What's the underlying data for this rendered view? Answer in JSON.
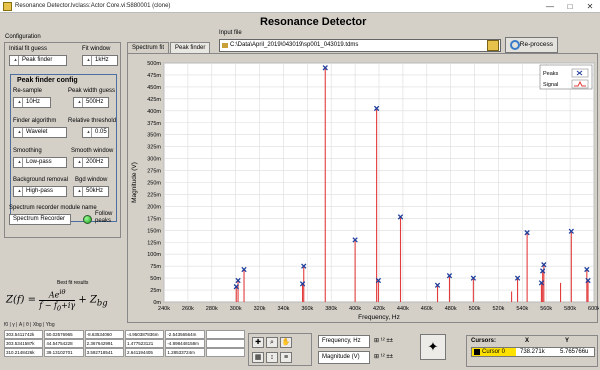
{
  "window": {
    "title": "Resonance Detector.lvclass:Actor Core.vi:5880001 (clone)",
    "controls": [
      "—",
      "□",
      "✕"
    ]
  },
  "app_title": "Resonance Detector",
  "configuration": {
    "label": "Configuration",
    "initial_fit_guess": {
      "label": "Initial fit guess",
      "value": "Peak finder"
    },
    "fit_window": {
      "label": "Fit window",
      "value": "1kHz"
    },
    "peak_finder": {
      "title": "Peak finder config",
      "resample": {
        "label": "Re-sample",
        "value": "10Hz"
      },
      "peak_width_guess": {
        "label": "Peak width guess",
        "value": "500Hz"
      },
      "finder_algorithm": {
        "label": "Finder algorithm",
        "value": "Wavelet"
      },
      "relative_threshold": {
        "label": "Relative threshold",
        "value": "0.05"
      },
      "smoothing": {
        "label": "Smoothing",
        "value": "Low-pass"
      },
      "smooth_window": {
        "label": "Smooth window",
        "value": "200Hz"
      },
      "background_removal": {
        "label": "Background removal",
        "value": "High-pass"
      },
      "bgd_window": {
        "label": "Bgd window",
        "value": "50kHz"
      }
    },
    "recorder": {
      "label": "Spectrum recorder module name",
      "value": "Spectrum Recorder",
      "follow_label": "Follow peaks"
    }
  },
  "tabs": [
    {
      "label": "Spectrum fit",
      "active": false
    },
    {
      "label": "Peak finder",
      "active": true
    }
  ],
  "input_file": {
    "label": "Input file",
    "path": "C:\\Data\\April_2019\\043019\\sp001_043019.tdms"
  },
  "reprocess_label": "Re-process",
  "legend": [
    {
      "name": "Peaks",
      "color": "#1f3e9c"
    },
    {
      "name": "Signal",
      "color": "#e23c3c"
    }
  ],
  "chart_data": {
    "type": "line",
    "xlabel": "Frequency, Hz",
    "ylabel": "Magnitude (V)",
    "xlim": [
      240000,
      600000
    ],
    "ylim": [
      0,
      500
    ],
    "x_ticks": [
      "240k",
      "260k",
      "280k",
      "300k",
      "320k",
      "340k",
      "360k",
      "380k",
      "400k",
      "420k",
      "440k",
      "460k",
      "480k",
      "500k",
      "520k",
      "540k",
      "560k",
      "580k",
      "600k"
    ],
    "y_ticks": [
      "0m",
      "25m",
      "50m",
      "75m",
      "100m",
      "125m",
      "150m",
      "175m",
      "200m",
      "225m",
      "250m",
      "275m",
      "300m",
      "325m",
      "350m",
      "375m",
      "400m",
      "425m",
      "450m",
      "475m",
      "500m"
    ],
    "grid": true,
    "legend_position": "top-right",
    "signal_peaks": [
      {
        "x": 300500,
        "y": 32
      },
      {
        "x": 302000,
        "y": 45
      },
      {
        "x": 307000,
        "y": 68
      },
      {
        "x": 356000,
        "y": 38
      },
      {
        "x": 357000,
        "y": 75
      },
      {
        "x": 375000,
        "y": 490
      },
      {
        "x": 400000,
        "y": 130
      },
      {
        "x": 418000,
        "y": 405
      },
      {
        "x": 419500,
        "y": 45
      },
      {
        "x": 438000,
        "y": 178
      },
      {
        "x": 469000,
        "y": 35
      },
      {
        "x": 479000,
        "y": 55
      },
      {
        "x": 499000,
        "y": 50
      },
      {
        "x": 531000,
        "y": 22
      },
      {
        "x": 536000,
        "y": 50
      },
      {
        "x": 544000,
        "y": 145
      },
      {
        "x": 556000,
        "y": 40
      },
      {
        "x": 557000,
        "y": 65
      },
      {
        "x": 558000,
        "y": 78
      },
      {
        "x": 572000,
        "y": 40
      },
      {
        "x": 581000,
        "y": 148
      },
      {
        "x": 594000,
        "y": 68
      },
      {
        "x": 595000,
        "y": 45
      }
    ],
    "detected_peaks": [
      {
        "x": 300500,
        "y": 32
      },
      {
        "x": 302000,
        "y": 45
      },
      {
        "x": 307000,
        "y": 68
      },
      {
        "x": 356000,
        "y": 38
      },
      {
        "x": 357000,
        "y": 75
      },
      {
        "x": 375000,
        "y": 490
      },
      {
        "x": 400000,
        "y": 130
      },
      {
        "x": 418000,
        "y": 405
      },
      {
        "x": 419500,
        "y": 45
      },
      {
        "x": 438000,
        "y": 178
      },
      {
        "x": 469000,
        "y": 35
      },
      {
        "x": 479000,
        "y": 55
      },
      {
        "x": 499000,
        "y": 50
      },
      {
        "x": 536000,
        "y": 50
      },
      {
        "x": 544000,
        "y": 145
      },
      {
        "x": 556000,
        "y": 40
      },
      {
        "x": 557000,
        "y": 65
      },
      {
        "x": 558000,
        "y": 78
      },
      {
        "x": 581000,
        "y": 148
      },
      {
        "x": 594000,
        "y": 68
      },
      {
        "x": 595000,
        "y": 45
      }
    ]
  },
  "best_fit_results_label": "Best fit results",
  "fit_table": {
    "header": "f0   |   γ   |   A   |   θ   |   Xbg   |   Ybg",
    "rows": [
      [
        "303.5411742k",
        "50.02576965",
        "-8.63534060",
        "-4.950387836m",
        "-2.54356564m",
        ""
      ],
      [
        "303.5341587k",
        "44.54754228",
        "2.367642991",
        "1.477523121",
        "-4.898448158m",
        ""
      ],
      [
        "310.2148426k",
        "39.13102701",
        "3.592718541",
        "2.641194405",
        "1.28533724m",
        ""
      ]
    ]
  },
  "scales": [
    {
      "label": "Frequency, Hz",
      "icons": "⊞ ¹² ±±"
    },
    {
      "label": "Magnitude (V)",
      "icons": "⊞ ¹² ±±"
    }
  ],
  "cursors": {
    "label": "Cursors:",
    "x_label": "X",
    "y_label": "Y",
    "rows": [
      {
        "name": "Cursor 0",
        "x": "738.271k",
        "y": "5.765766u"
      }
    ]
  }
}
